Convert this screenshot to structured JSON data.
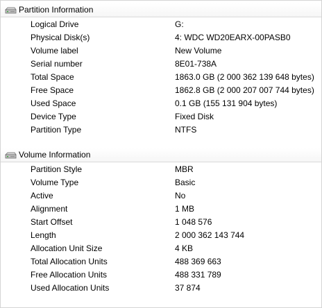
{
  "partition_section": {
    "title": "Partition Information",
    "icon": "drive-icon",
    "rows": [
      {
        "label": "Logical Drive",
        "value": "G:"
      },
      {
        "label": "Physical Disk(s)",
        "value": "4: WDC WD20EARX-00PASB0"
      },
      {
        "label": "Volume label",
        "value": "New Volume"
      },
      {
        "label": "Serial number",
        "value": "8E01-738A"
      },
      {
        "label": "Total Space",
        "value": "1863.0 GB (2 000 362 139 648 bytes)"
      },
      {
        "label": "Free Space",
        "value": "1862.8 GB (2 000 207 007 744 bytes)"
      },
      {
        "label": "Used Space",
        "value": "0.1 GB (155 131 904 bytes)"
      },
      {
        "label": "Device Type",
        "value": "Fixed Disk"
      },
      {
        "label": "Partition Type",
        "value": "NTFS"
      }
    ]
  },
  "volume_section": {
    "title": "Volume Information",
    "icon": "drive-icon",
    "rows": [
      {
        "label": "Partition Style",
        "value": "MBR"
      },
      {
        "label": "Volume Type",
        "value": "Basic"
      },
      {
        "label": "Active",
        "value": "No"
      },
      {
        "label": "Alignment",
        "value": "1 MB"
      },
      {
        "label": "Start Offset",
        "value": "1 048 576"
      },
      {
        "label": "Length",
        "value": "2 000 362 143 744"
      },
      {
        "label": "Allocation Unit Size",
        "value": "4 KB"
      },
      {
        "label": "Total Allocation Units",
        "value": "488 369 663"
      },
      {
        "label": "Free Allocation Units",
        "value": "488 331 789"
      },
      {
        "label": "Used Allocation Units",
        "value": "37 874"
      }
    ]
  }
}
